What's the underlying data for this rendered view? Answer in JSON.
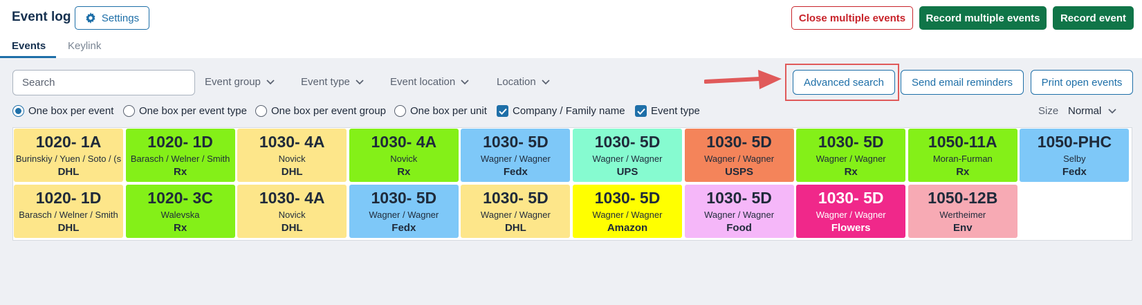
{
  "header": {
    "title": "Event log",
    "settings_label": "Settings",
    "close_multiple_label": "Close multiple events",
    "record_multiple_label": "Record multiple events",
    "record_label": "Record event"
  },
  "tabs": [
    {
      "label": "Events",
      "active": true
    },
    {
      "label": "Keylink",
      "active": false
    }
  ],
  "filters": {
    "search_placeholder": "Search",
    "dropdowns": [
      "Event group",
      "Event type",
      "Event location",
      "Location"
    ]
  },
  "actions": {
    "advanced_search": "Advanced search",
    "send_reminders": "Send email reminders",
    "print_open": "Print open events"
  },
  "display_options": {
    "radios": [
      {
        "label": "One box per event",
        "selected": true
      },
      {
        "label": "One box per event type",
        "selected": false
      },
      {
        "label": "One box per event group",
        "selected": false
      },
      {
        "label": "One box per unit",
        "selected": false
      }
    ],
    "checkboxes": [
      {
        "label": "Company / Family name",
        "checked": true
      },
      {
        "label": "Event type",
        "checked": true
      }
    ],
    "size_label": "Size",
    "size_value": "Normal"
  },
  "colors": {
    "accent": "#1e6fa8",
    "danger": "#c8242b",
    "success": "#107548",
    "highlight": "#e05a5a"
  },
  "events": [
    {
      "unit": "1020- 1A",
      "name": "Burinskiy / Yuen / Soto / (s",
      "carrier": "DHL",
      "bg": "#fde68a",
      "fg": "#1f2a3a"
    },
    {
      "unit": "1020- 1D",
      "name": "Barasch / Welner / Smith",
      "carrier": "Rx",
      "bg": "#84f018",
      "fg": "#1f2a3a"
    },
    {
      "unit": "1030- 4A",
      "name": "Novick",
      "carrier": "DHL",
      "bg": "#fde68a",
      "fg": "#1f2a3a"
    },
    {
      "unit": "1030- 4A",
      "name": "Novick",
      "carrier": "Rx",
      "bg": "#84f018",
      "fg": "#1f2a3a"
    },
    {
      "unit": "1030- 5D",
      "name": "Wagner / Wagner",
      "carrier": "Fedx",
      "bg": "#7ec8f8",
      "fg": "#1f2a3a"
    },
    {
      "unit": "1030- 5D",
      "name": "Wagner / Wagner",
      "carrier": "UPS",
      "bg": "#86fbd0",
      "fg": "#1f2a3a"
    },
    {
      "unit": "1030- 5D",
      "name": "Wagner / Wagner",
      "carrier": "USPS",
      "bg": "#f4845a",
      "fg": "#1f2a3a"
    },
    {
      "unit": "1030- 5D",
      "name": "Wagner / Wagner",
      "carrier": "Rx",
      "bg": "#84f018",
      "fg": "#1f2a3a"
    },
    {
      "unit": "1050-11A",
      "name": "Moran-Furman",
      "carrier": "Rx",
      "bg": "#84f018",
      "fg": "#1f2a3a"
    },
    {
      "unit": "1050-PHC",
      "name": "Selby",
      "carrier": "Fedx",
      "bg": "#7ec8f8",
      "fg": "#1f2a3a"
    },
    {
      "unit": "1020- 1D",
      "name": "Barasch / Welner / Smith",
      "carrier": "DHL",
      "bg": "#fde68a",
      "fg": "#1f2a3a"
    },
    {
      "unit": "1020- 3C",
      "name": "Walevska",
      "carrier": "Rx",
      "bg": "#84f018",
      "fg": "#1f2a3a"
    },
    {
      "unit": "1030- 4A",
      "name": "Novick",
      "carrier": "DHL",
      "bg": "#fde68a",
      "fg": "#1f2a3a"
    },
    {
      "unit": "1030- 5D",
      "name": "Wagner / Wagner",
      "carrier": "Fedx",
      "bg": "#7ec8f8",
      "fg": "#1f2a3a"
    },
    {
      "unit": "1030- 5D",
      "name": "Wagner / Wagner",
      "carrier": "DHL",
      "bg": "#fde68a",
      "fg": "#1f2a3a"
    },
    {
      "unit": "1030- 5D",
      "name": "Wagner / Wagner",
      "carrier": "Amazon",
      "bg": "#ffff00",
      "fg": "#1f2a3a"
    },
    {
      "unit": "1030- 5D",
      "name": "Wagner / Wagner",
      "carrier": "Food",
      "bg": "#f5b7f9",
      "fg": "#1f2a3a"
    },
    {
      "unit": "1030- 5D",
      "name": "Wagner / Wagner",
      "carrier": "Flowers",
      "bg": "#f0288a",
      "fg": "#ffffff"
    },
    {
      "unit": "1050-12B",
      "name": "Wertheimer",
      "carrier": "Env",
      "bg": "#f7aab4",
      "fg": "#1f2a3a"
    }
  ]
}
